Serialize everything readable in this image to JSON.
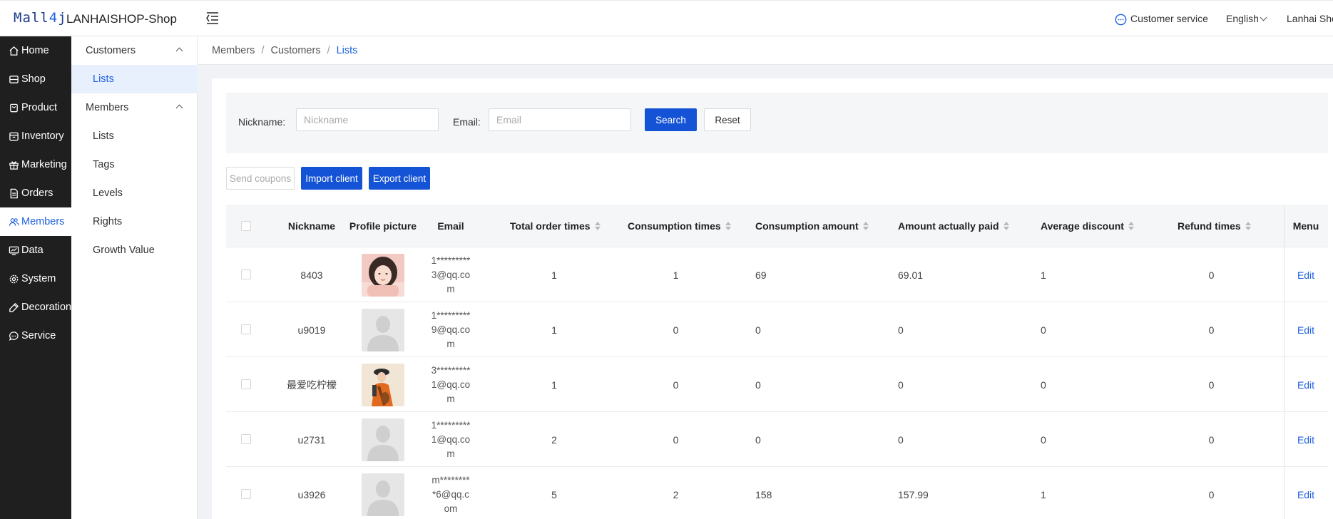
{
  "header": {
    "logo": "Mall4j",
    "shop_name": "LANHAISHOP-Shop",
    "customer_service": "Customer service",
    "language": "English",
    "user": "Lanhai Shop"
  },
  "sidebar": {
    "items": [
      {
        "label": "Home",
        "icon": "home-icon"
      },
      {
        "label": "Shop",
        "icon": "shop-icon"
      },
      {
        "label": "Product",
        "icon": "product-icon"
      },
      {
        "label": "Inventory",
        "icon": "inventory-icon"
      },
      {
        "label": "Marketing",
        "icon": "gift-icon"
      },
      {
        "label": "Orders",
        "icon": "orders-icon"
      },
      {
        "label": "Members",
        "icon": "members-icon"
      },
      {
        "label": "Data",
        "icon": "data-icon"
      },
      {
        "label": "System",
        "icon": "gear-icon"
      },
      {
        "label": "Decoration",
        "icon": "decoration-icon"
      },
      {
        "label": "Service",
        "icon": "chat-icon"
      }
    ]
  },
  "subnav": {
    "group1": "Customers",
    "group1_items": [
      "Lists"
    ],
    "group2": "Members",
    "group2_items": [
      "Lists",
      "Tags",
      "Levels",
      "Rights",
      "Growth Value"
    ]
  },
  "breadcrumb": [
    "Members",
    "Customers",
    "Lists"
  ],
  "filters": {
    "nickname_label": "Nickname:",
    "nickname_placeholder": "Nickname",
    "nickname_value": "",
    "email_label": "Email:",
    "email_placeholder": "Email",
    "email_value": "",
    "search": "Search",
    "reset": "Reset"
  },
  "actions": {
    "send_coupons": "Send coupons",
    "import_client": "Import client",
    "export_client": "Export client"
  },
  "table": {
    "columns": {
      "nickname": "Nickname",
      "profile_picture": "Profile picture",
      "email": "Email",
      "total_order_times": "Total order times",
      "consumption_times": "Consumption times",
      "consumption_amount": "Consumption amount",
      "amount_actually_paid": "Amount actually paid",
      "average_discount": "Average discount",
      "refund_times": "Refund times",
      "menu": "Menu"
    },
    "rows": [
      {
        "nickname": "8403",
        "avatar": "photo-woman",
        "email": "1*********3@qq.com",
        "total_order_times": "1",
        "consumption_times": "1",
        "consumption_amount": "69",
        "amount_actually_paid": "69.01",
        "average_discount": "1",
        "refund_times": "0",
        "menu": "Edit"
      },
      {
        "nickname": "u9019",
        "avatar": "default-avatar",
        "email": "1*********9@qq.com",
        "total_order_times": "1",
        "consumption_times": "0",
        "consumption_amount": "0",
        "amount_actually_paid": "0",
        "average_discount": "0",
        "refund_times": "0",
        "menu": "Edit"
      },
      {
        "nickname": "最爱吃柠檬",
        "avatar": "photo-musician",
        "email": "3*********1@qq.com",
        "total_order_times": "1",
        "consumption_times": "0",
        "consumption_amount": "0",
        "amount_actually_paid": "0",
        "average_discount": "0",
        "refund_times": "0",
        "menu": "Edit"
      },
      {
        "nickname": "u2731",
        "avatar": "default-avatar",
        "email": "1*********1@qq.com",
        "total_order_times": "2",
        "consumption_times": "0",
        "consumption_amount": "0",
        "amount_actually_paid": "0",
        "average_discount": "0",
        "refund_times": "0",
        "menu": "Edit"
      },
      {
        "nickname": "u3926",
        "avatar": "default-avatar",
        "email": "m*********6@qq.com",
        "total_order_times": "5",
        "consumption_times": "2",
        "consumption_amount": "158",
        "amount_actually_paid": "157.99",
        "average_discount": "1",
        "refund_times": "0",
        "menu": "Edit"
      }
    ]
  },
  "colors": {
    "primary": "#1553d6",
    "link": "#1e60e0",
    "sidebar_bg": "#1f1f1f",
    "submenu_active_bg": "#e8f0fd"
  }
}
